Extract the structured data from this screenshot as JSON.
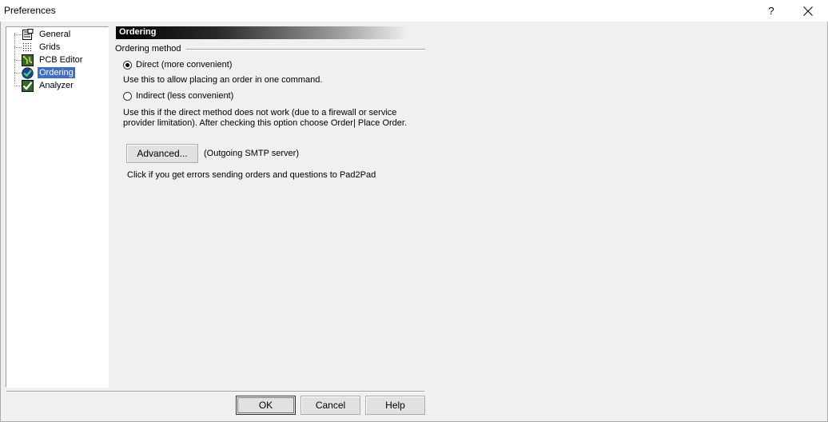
{
  "window": {
    "title": "Preferences",
    "help_glyph": "?"
  },
  "tree": {
    "items": [
      {
        "label": "General",
        "icon": "general-settings-icon"
      },
      {
        "label": "Grids",
        "icon": "grid-icon"
      },
      {
        "label": "PCB Editor",
        "icon": "pcb-editor-icon"
      },
      {
        "label": "Ordering",
        "icon": "ordering-checkmark-icon",
        "selected": true
      },
      {
        "label": "Analyzer",
        "icon": "analyzer-icon"
      }
    ]
  },
  "panel": {
    "title": "Ordering",
    "group_label": "Ordering method",
    "direct": {
      "label": "Direct (more convenient)",
      "checked": true,
      "description": "Use this to allow placing an order in one command."
    },
    "indirect": {
      "label": "Indirect (less convenient)",
      "checked": false,
      "description_line1": "Use this if the direct method does not work (due to a firewall or service",
      "description_line2": "provider limitation). After checking this option choose Order| Place Order."
    },
    "advanced_button": "Advanced...",
    "advanced_note": "(Outgoing SMTP server)",
    "advanced_hint": "Click if you get errors sending orders and questions to Pad2Pad"
  },
  "footer": {
    "ok": "OK",
    "cancel": "Cancel",
    "help": "Help"
  },
  "colors": {
    "selection": "#3a6ecf",
    "dialog_bg": "#f0f0f0"
  }
}
